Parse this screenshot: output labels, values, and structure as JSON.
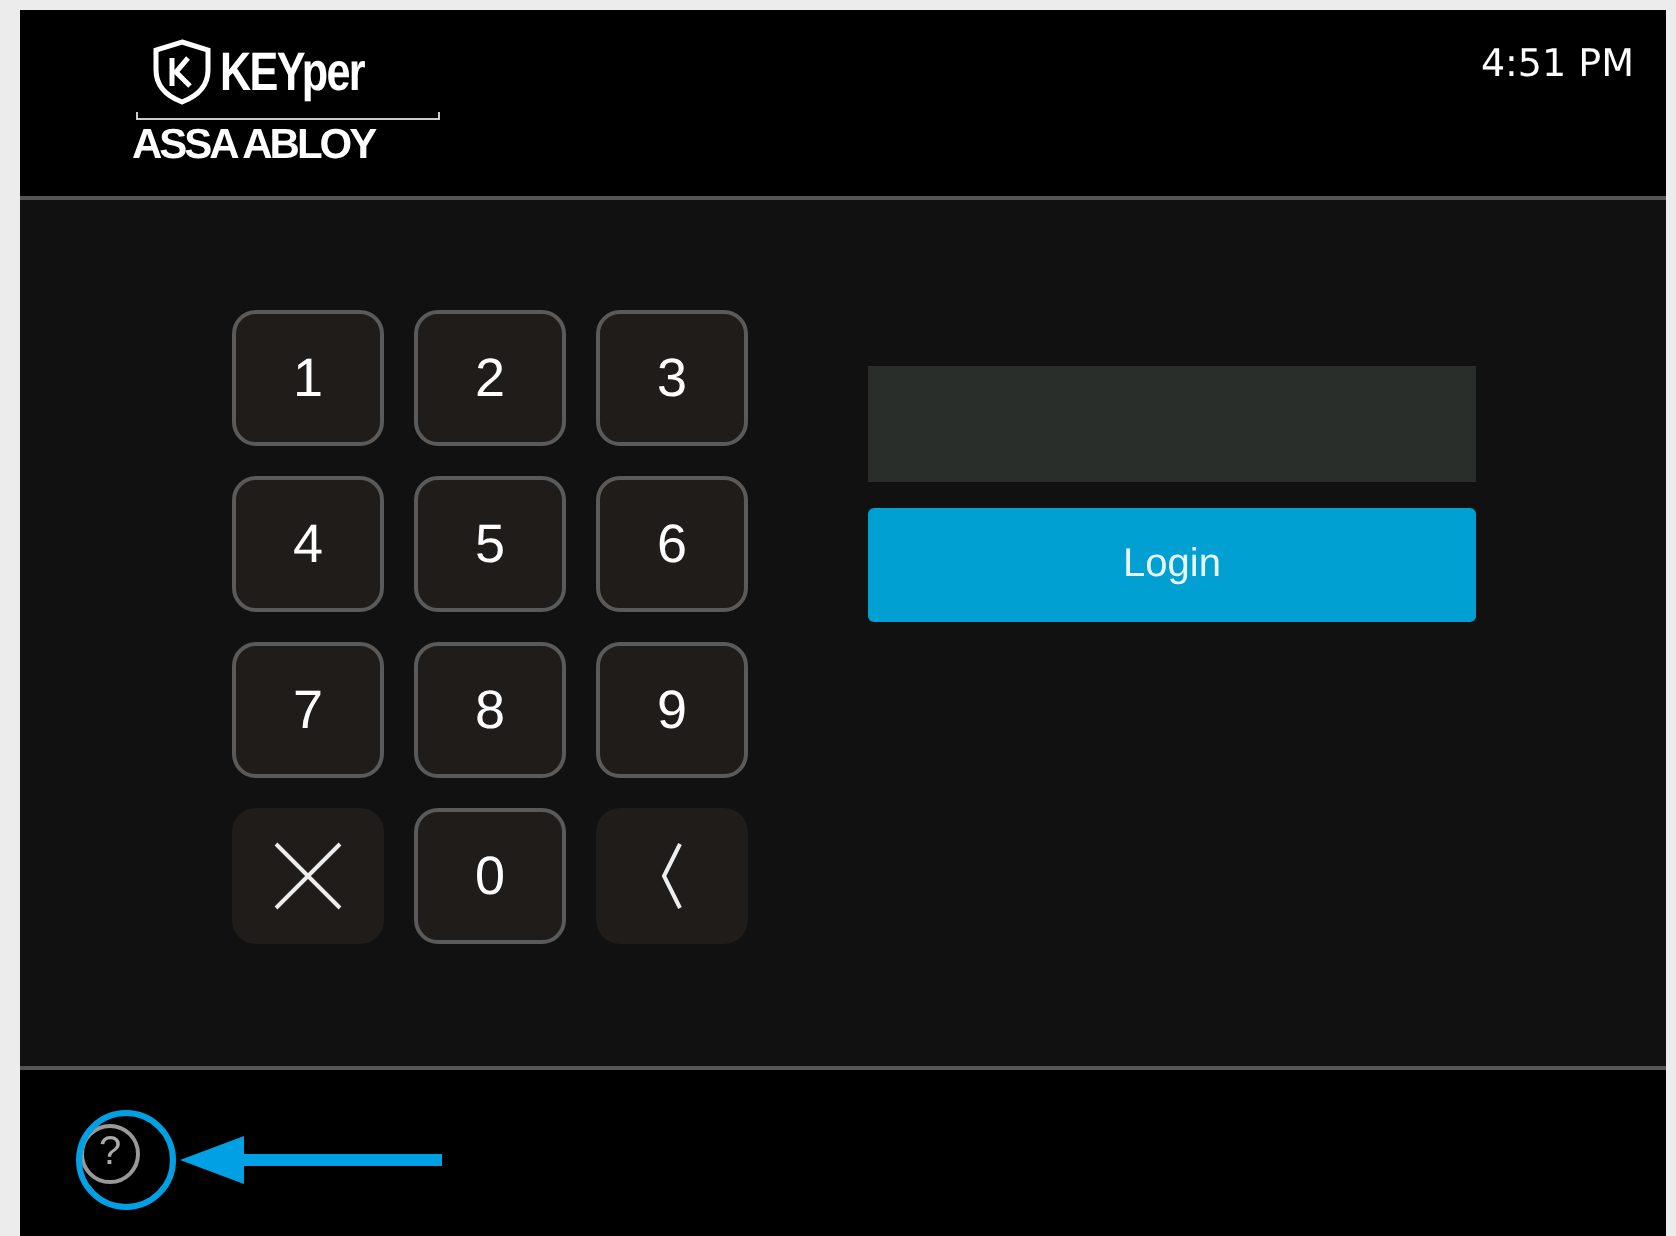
{
  "header": {
    "brand": "KEYper",
    "company": "ASSA ABLOY",
    "time": "4:51 PM"
  },
  "keypad": [
    {
      "kind": "digit",
      "label": "1"
    },
    {
      "kind": "digit",
      "label": "2"
    },
    {
      "kind": "digit",
      "label": "3"
    },
    {
      "kind": "digit",
      "label": "4"
    },
    {
      "kind": "digit",
      "label": "5"
    },
    {
      "kind": "digit",
      "label": "6"
    },
    {
      "kind": "digit",
      "label": "7"
    },
    {
      "kind": "digit",
      "label": "8"
    },
    {
      "kind": "digit",
      "label": "9"
    },
    {
      "kind": "clear"
    },
    {
      "kind": "digit",
      "label": "0"
    },
    {
      "kind": "back"
    }
  ],
  "login": {
    "button": "Login"
  },
  "footer": {
    "help": "?",
    "highlighted": true
  }
}
